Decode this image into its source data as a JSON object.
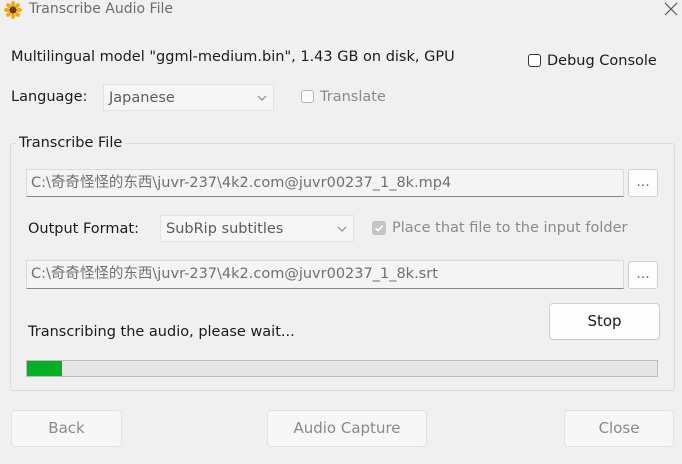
{
  "window": {
    "title": "Transcribe Audio File"
  },
  "model_info": "Multilingual model \"ggml-medium.bin\", 1.43 GB on disk, GPU",
  "debug_console": {
    "label": "Debug Console",
    "checked": false
  },
  "language": {
    "label": "Language:",
    "selected": "Japanese"
  },
  "translate": {
    "label": "Translate",
    "checked": false,
    "enabled": false
  },
  "transcribe_group": {
    "label": "Transcribe File",
    "input_path": "C:\\奇奇怪怪的东西\\juvr-237\\4k2.com@juvr00237_1_8k.mp4",
    "input_browse_label": "...",
    "output_format_label": "Output Format:",
    "output_format_selected": "SubRip subtitles",
    "place_in_input_folder": {
      "label": "Place that file to the input folder",
      "checked": true,
      "enabled": false
    },
    "output_path": "C:\\奇奇怪怪的东西\\juvr-237\\4k2.com@juvr00237_1_8k.srt",
    "output_browse_label": "..."
  },
  "status": {
    "text": "Transcribing the audio, please wait...",
    "stop_label": "Stop",
    "progress_fraction": 0.055
  },
  "footer": {
    "back_label": "Back",
    "audio_capture_label": "Audio Capture",
    "close_label": "Close"
  },
  "colors": {
    "progress": "#06b025",
    "background": "#f0f0f0"
  },
  "icons": {
    "app": "sunflower-icon",
    "close": "close-icon",
    "dropdown": "chevron-down-icon",
    "check": "checkmark-icon"
  }
}
